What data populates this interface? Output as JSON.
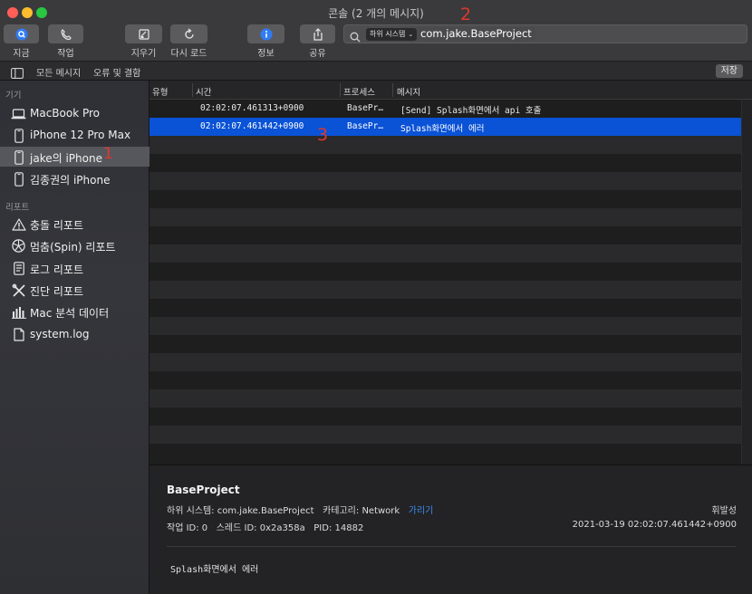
{
  "window": {
    "title": "콘솔 (2 개의 메시지)"
  },
  "toolbar": {
    "now_label": "지금",
    "activity_label": "작업",
    "clear_label": "지우기",
    "reload_label": "다시 로드",
    "info_label": "정보",
    "share_label": "공유"
  },
  "search": {
    "token_label": "하위 시스템",
    "value": "com.jake.BaseProject"
  },
  "filterbar": {
    "all_messages": "모든 메시지",
    "errors_faults": "오류 및 결함",
    "save_label": "저장"
  },
  "sidebar": {
    "devices_header": "기기",
    "devices": [
      {
        "label": "MacBook Pro",
        "icon": "laptop-icon"
      },
      {
        "label": "iPhone 12 Pro Max",
        "icon": "iphone-icon"
      },
      {
        "label": "jake의 iPhone",
        "icon": "iphone-icon"
      },
      {
        "label": "김종권의 iPhone",
        "icon": "iphone-icon"
      }
    ],
    "reports_header": "리포트",
    "reports": [
      {
        "label": "충돌 리포트",
        "icon": "warning-icon"
      },
      {
        "label": "멈춤(Spin) 리포트",
        "icon": "spin-icon"
      },
      {
        "label": "로그 리포트",
        "icon": "log-icon"
      },
      {
        "label": "진단 리포트",
        "icon": "tools-icon"
      },
      {
        "label": "Mac 분석 데이터",
        "icon": "chart-icon"
      },
      {
        "label": "system.log",
        "icon": "file-icon"
      }
    ]
  },
  "table": {
    "columns": [
      "유형",
      "시간",
      "프로세스",
      "메시지"
    ],
    "rows": [
      {
        "type": "",
        "time": "02:02:07.461313+0900",
        "process": "BasePr…",
        "message": "[Send] Splash화면에서 api 호출"
      },
      {
        "type": "",
        "time": "02:02:07.461442+0900",
        "process": "BasePr…",
        "message": "Splash화면에서 에러"
      }
    ]
  },
  "detail": {
    "title": "BaseProject",
    "subsystem_label": "하위 시스템:",
    "subsystem": "com.jake.BaseProject",
    "category_label": "카테고리:",
    "category": "Network",
    "hide_link": "가리기",
    "volatile": "휘발성",
    "activity_id_label": "작업 ID:",
    "activity_id": "0",
    "thread_id_label": "스레드 ID:",
    "thread_id": "0x2a358a",
    "pid_label": "PID:",
    "pid": "14882",
    "timestamp": "2021-03-19 02:02:07.461442+0900",
    "message": "Splash화면에서 에러"
  },
  "annotations": [
    "1",
    "2",
    "3"
  ],
  "colors": {
    "selection": "#0a52d6",
    "annotation": "#e0362f",
    "link": "#3b8cf0"
  }
}
